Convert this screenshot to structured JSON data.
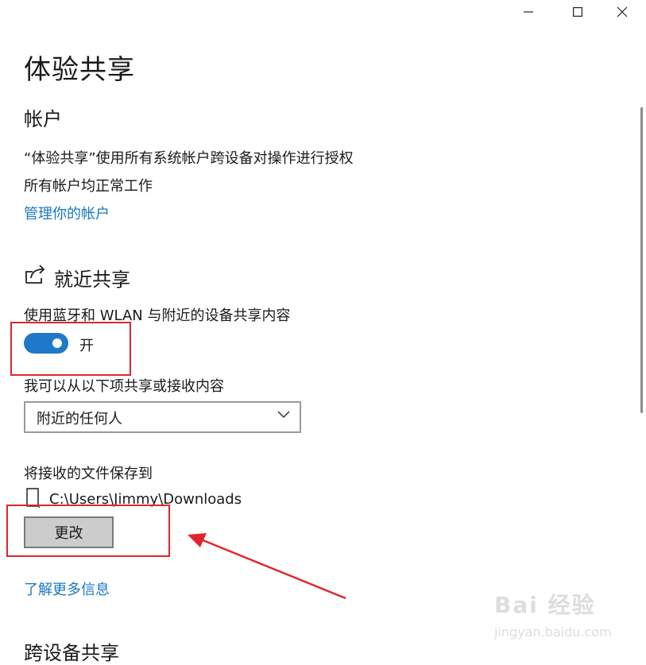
{
  "window": {
    "minimize_icon": "minimize-icon",
    "maximize_icon": "maximize-icon",
    "close_icon": "close-icon"
  },
  "page": {
    "title": "体验共享"
  },
  "account": {
    "heading": "帐户",
    "description": "“体验共享”使用所有系统帐户跨设备对操作进行授权",
    "status": "所有帐户均正常工作",
    "manage_link": "管理你的帐户"
  },
  "nearby": {
    "icon": "share-icon",
    "heading": "就近共享",
    "toggle_label_text": "使用蓝牙和 WLAN 与附近的设备共享内容",
    "toggle_state": "开",
    "toggle_on": true,
    "share_with_label": "我可以从以下项共享或接收内容",
    "share_with_value": "附近的任何人",
    "save_to_label": "将接收的文件保存到",
    "save_path": "C:\\Users\\Jimmy\\Downloads",
    "change_button": "更改",
    "learn_more_link": "了解更多信息"
  },
  "cross_device": {
    "heading": "跨设备共享"
  },
  "watermark": {
    "brand": "Bai 经验",
    "url": "jingyan.baidu.com"
  },
  "colors": {
    "accent": "#1f78c8",
    "link": "#1a78c2",
    "annotation_red": "#e0262c"
  }
}
